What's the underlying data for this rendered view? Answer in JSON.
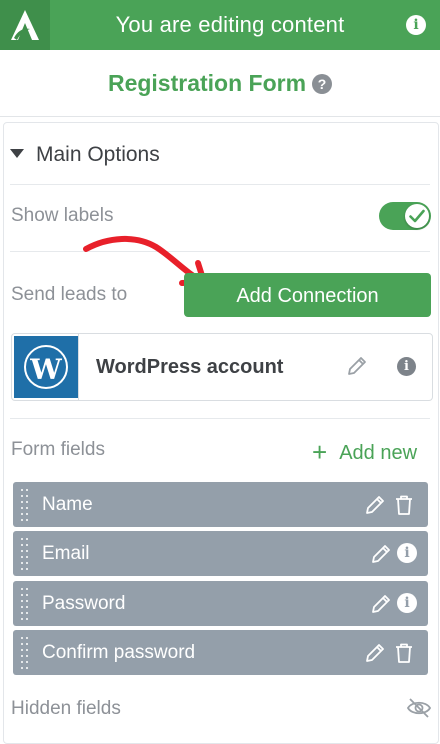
{
  "topbar": {
    "title": "You are editing content",
    "info_icon": "i"
  },
  "form": {
    "title": "Registration Form",
    "help_icon": "?"
  },
  "main_options": {
    "heading": "Main Options",
    "show_labels": {
      "label": "Show labels",
      "enabled": true
    },
    "send_leads": {
      "label": "Send leads to",
      "button": "Add Connection"
    },
    "connection": {
      "name": "WordPress account",
      "logo_letter": "W",
      "info_icon": "i"
    }
  },
  "form_fields": {
    "label": "Form fields",
    "add_new_icon": "+",
    "add_new": "Add new",
    "items": [
      {
        "label": "Name",
        "action": "delete"
      },
      {
        "label": "Email",
        "action": "info"
      },
      {
        "label": "Password",
        "action": "info"
      },
      {
        "label": "Confirm password",
        "action": "delete"
      }
    ]
  },
  "hidden_fields": {
    "label": "Hidden fields"
  },
  "colors": {
    "accent": "#4aa357",
    "field_row": "#949faa",
    "arrow": "#e8202a",
    "wordpress": "#1f6fa8"
  }
}
